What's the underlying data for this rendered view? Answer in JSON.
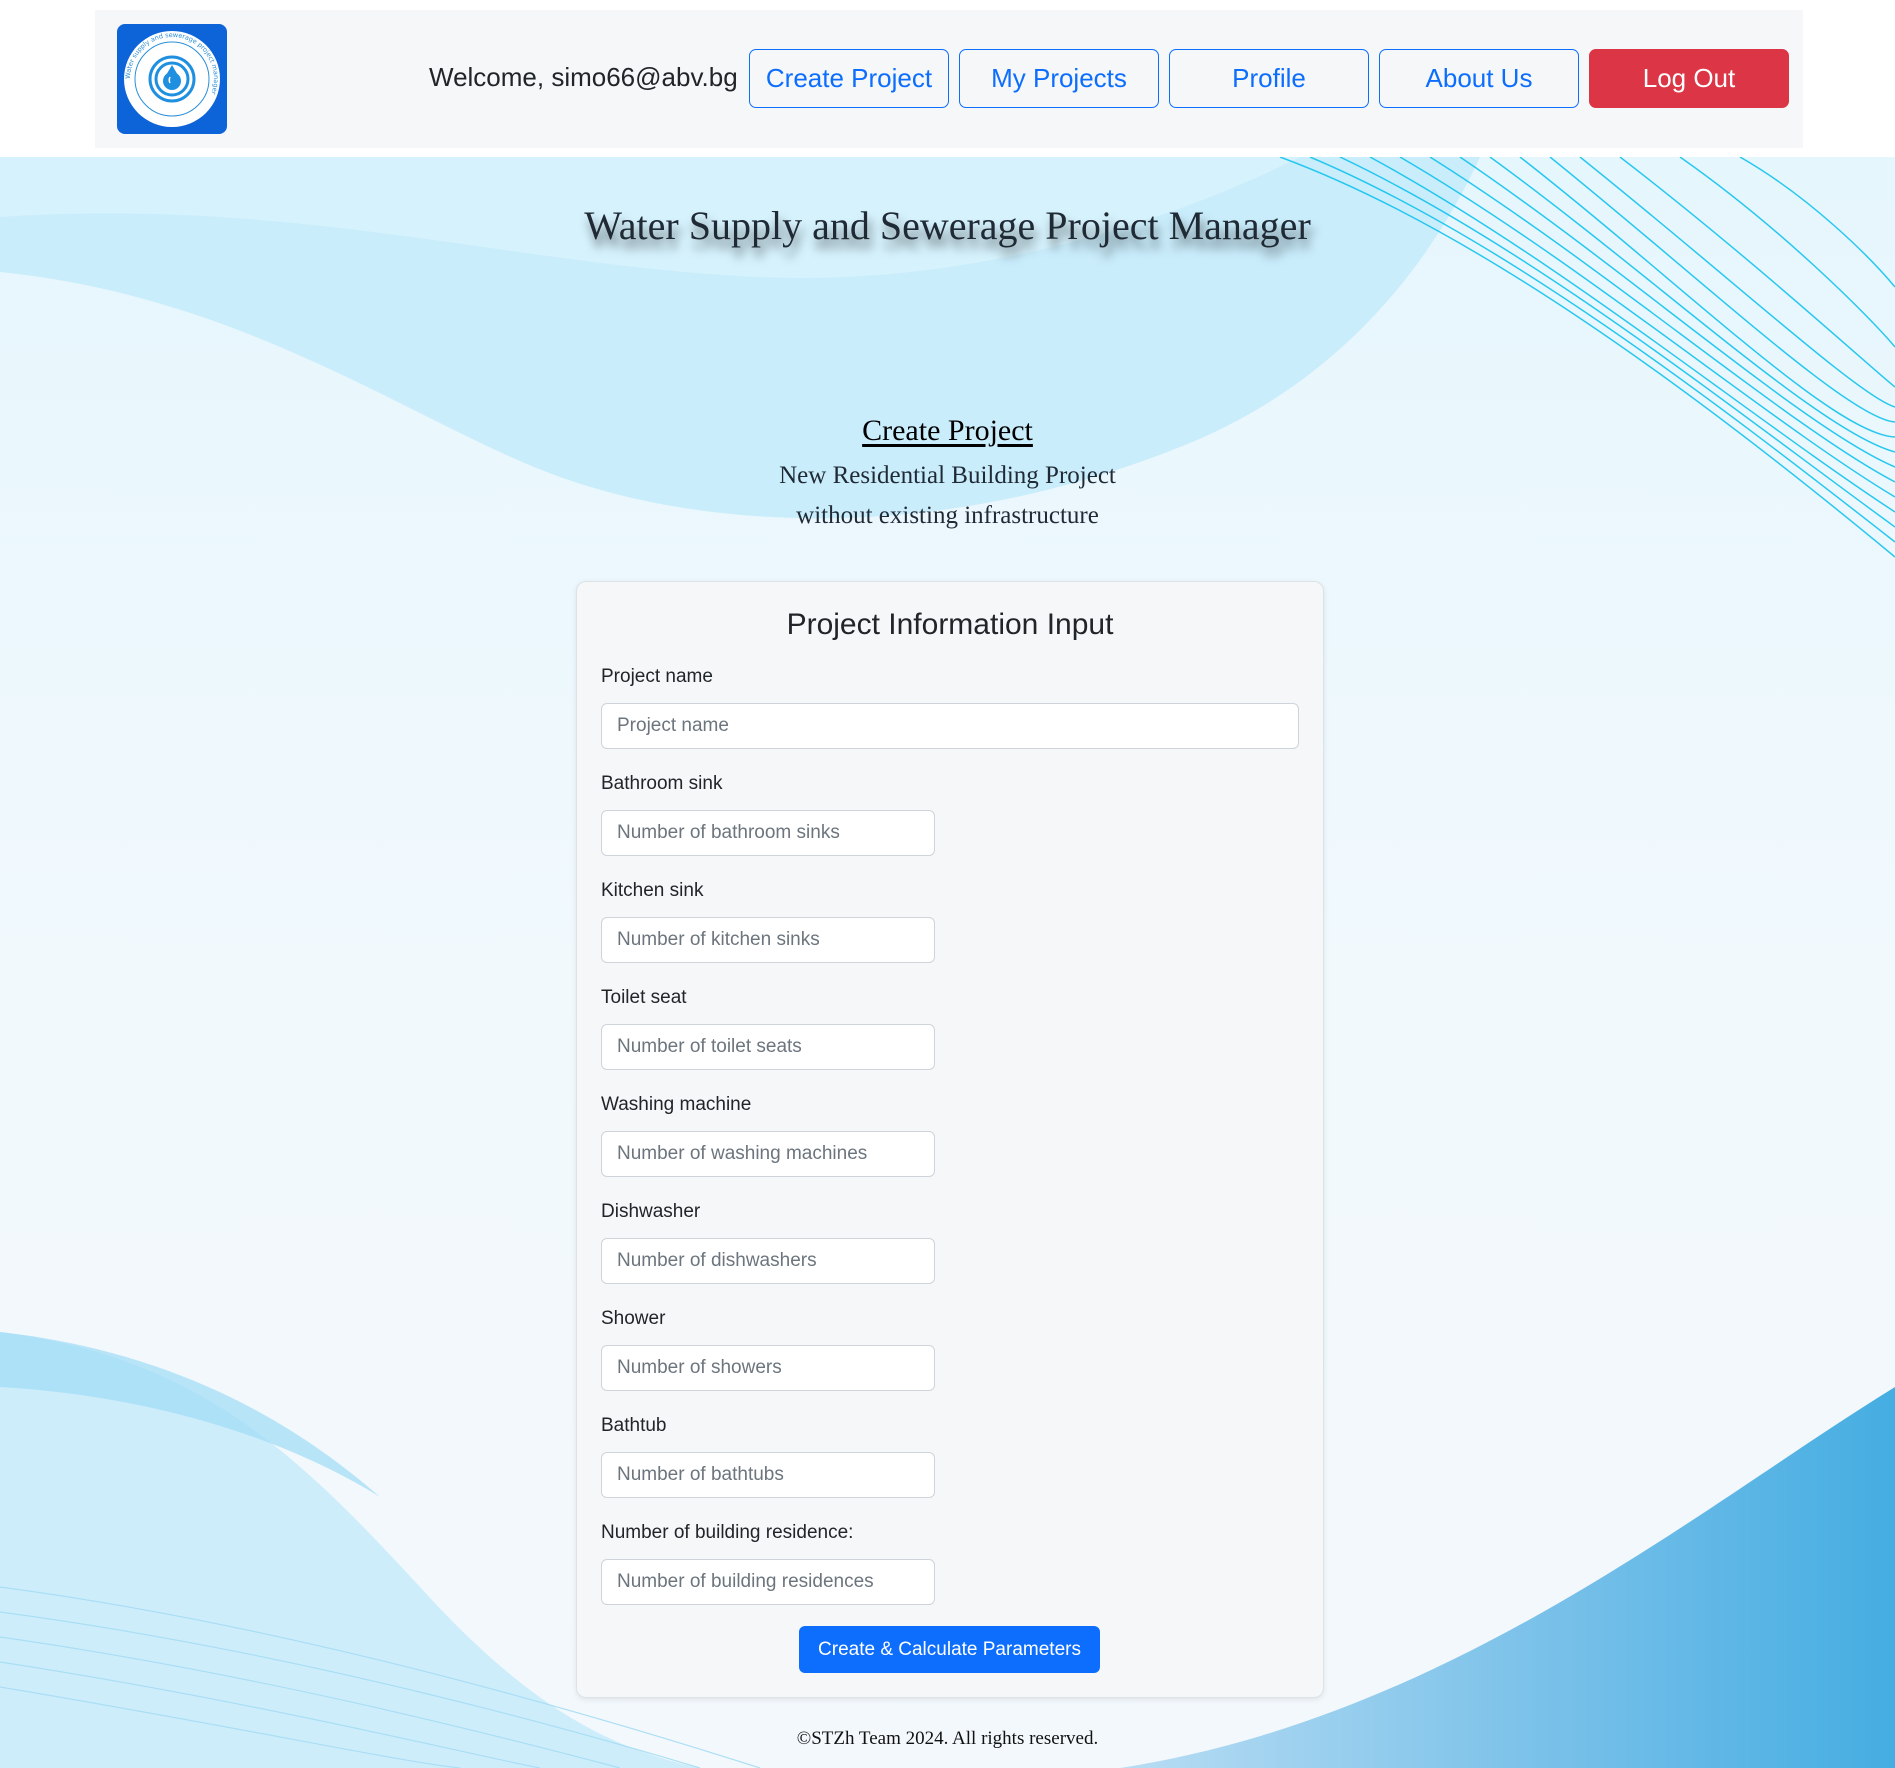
{
  "header": {
    "logo_icon": "water-drop-logo-icon",
    "logo_ring_text": "Water supply and sewerage project manager",
    "welcome_text": "Welcome, simo66@abv.bg",
    "nav": {
      "create_project": "Create Project",
      "my_projects": "My Projects",
      "profile": "Profile",
      "about_us": "About Us",
      "log_out": "Log Out"
    }
  },
  "page": {
    "title": "Water Supply and Sewerage Project Manager",
    "create_heading": "Create Project",
    "subtitle_line1": "New Residential Building Project",
    "subtitle_line2": "without existing infrastructure"
  },
  "form": {
    "title": "Project Information Input",
    "fields": [
      {
        "label": "Project name",
        "placeholder": "Project name",
        "value": ""
      },
      {
        "label": "Bathroom sink",
        "placeholder": "Number of bathroom sinks",
        "value": ""
      },
      {
        "label": "Kitchen sink",
        "placeholder": "Number of kitchen sinks",
        "value": ""
      },
      {
        "label": "Toilet seat",
        "placeholder": "Number of toilet seats",
        "value": ""
      },
      {
        "label": "Washing machine",
        "placeholder": "Number of washing machines",
        "value": ""
      },
      {
        "label": "Dishwasher",
        "placeholder": "Number of dishwashers",
        "value": ""
      },
      {
        "label": "Shower",
        "placeholder": "Number of showers",
        "value": ""
      },
      {
        "label": "Bathtub",
        "placeholder": "Number of bathtubs",
        "value": ""
      },
      {
        "label": "Number of building residence:",
        "placeholder": "Number of building residences",
        "value": ""
      }
    ],
    "submit_label": "Create & Calculate Parameters"
  },
  "footer": {
    "copyright": "©STZh Team 2024. All rights reserved."
  },
  "colors": {
    "primary": "#0d6efd",
    "danger": "#dc3545",
    "logo_bg": "#0d63d8",
    "wave_light": "#bfe9fb",
    "wave_line": "#13c3ee",
    "wave_dark": "#4aaee3"
  }
}
